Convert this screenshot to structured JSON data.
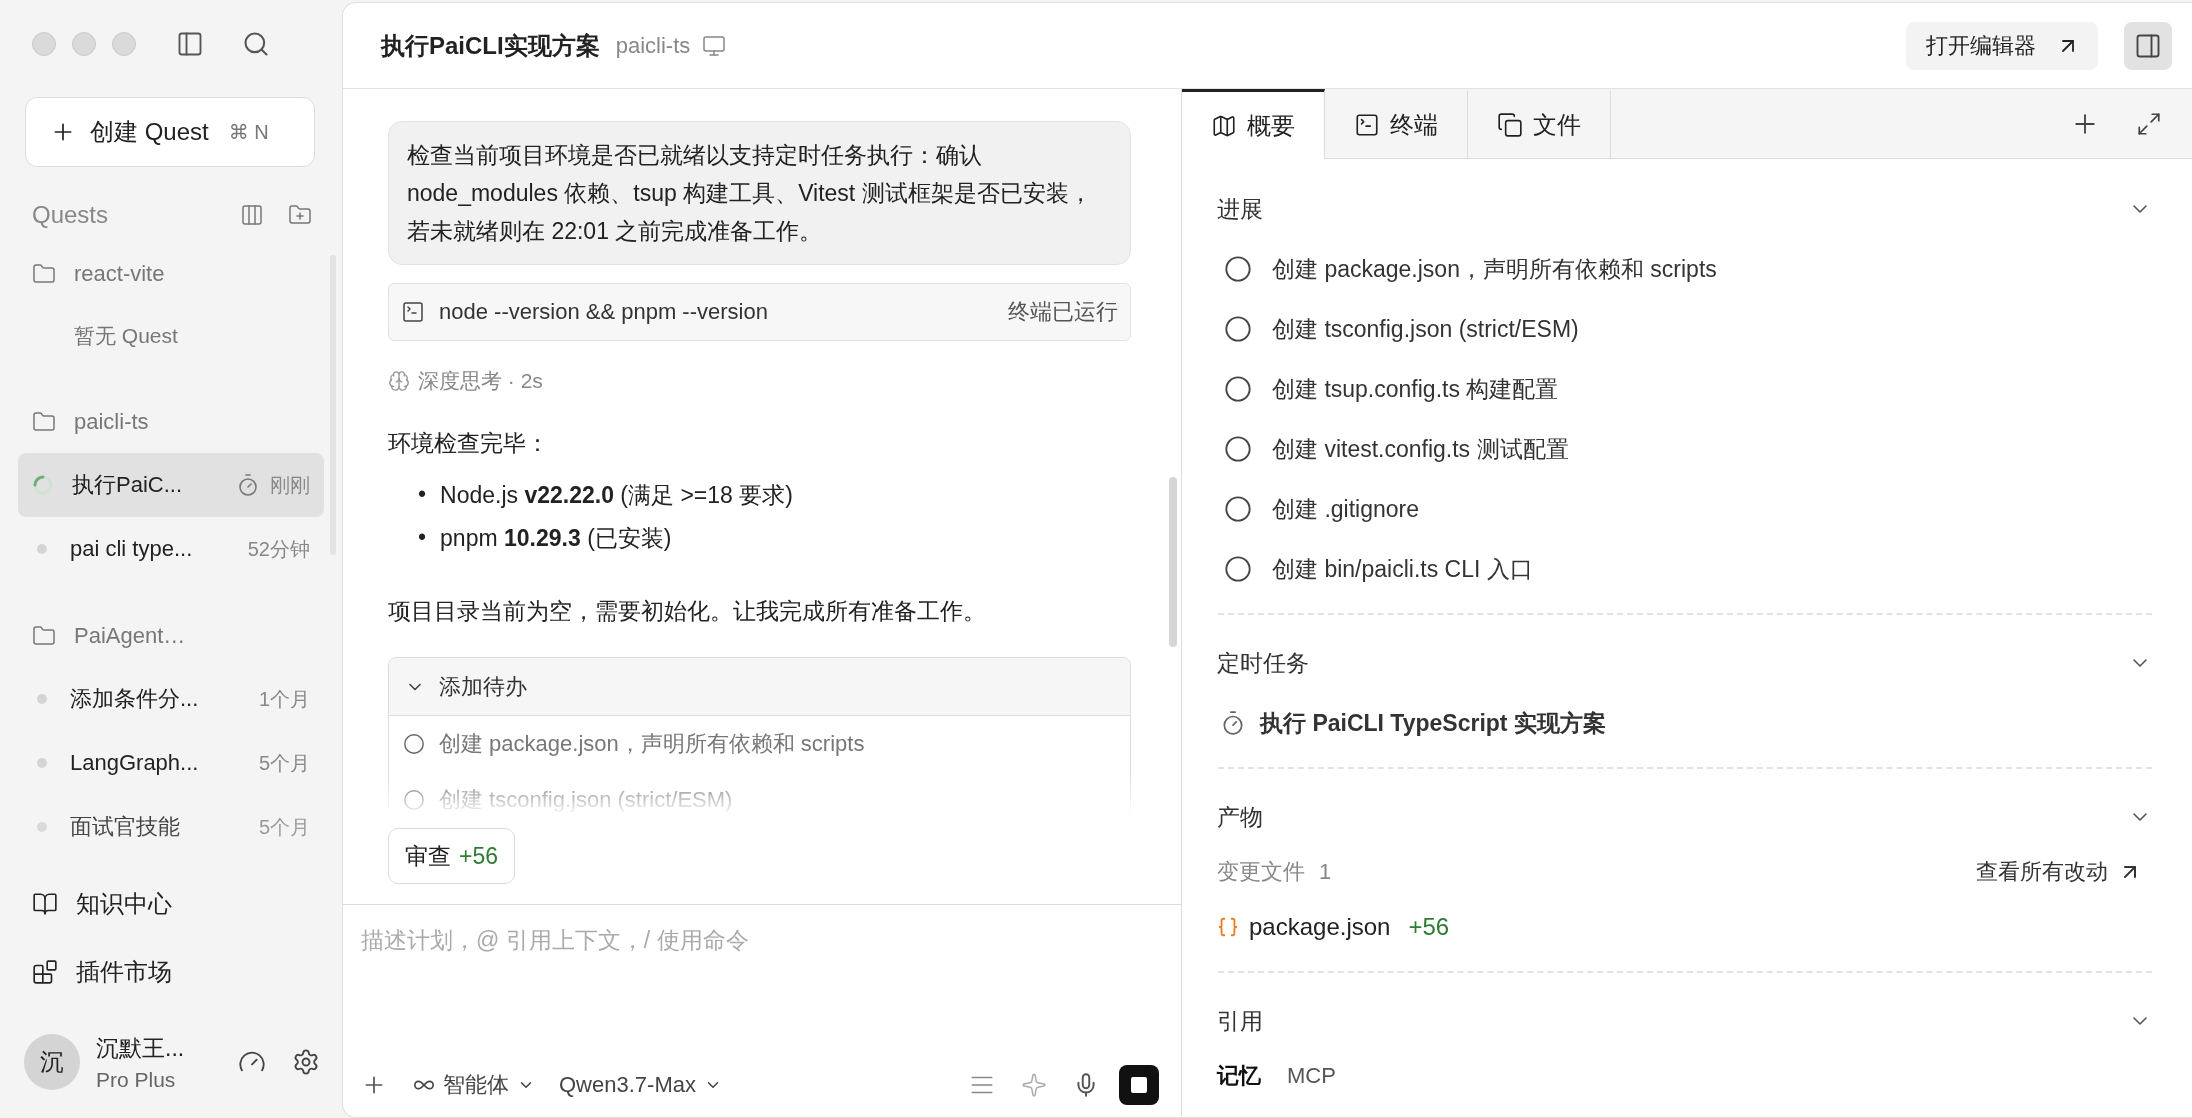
{
  "sidebar": {
    "create_button": {
      "label": "创建 Quest",
      "shortcut": "⌘ N"
    },
    "heading": "Quests",
    "groups": [
      {
        "name": "react-vite",
        "empty_text": "暂无 Quest"
      },
      {
        "name": "paicli-ts",
        "quests": [
          {
            "title": "执行PaiC...",
            "time": "刚刚",
            "kind": "running",
            "selected": true
          },
          {
            "title": "pai cli type...",
            "time": "52分钟",
            "kind": "idle",
            "selected": false
          }
        ]
      },
      {
        "name": "PaiAgent…",
        "quests": [
          {
            "title": "添加条件分...",
            "time": "1个月",
            "kind": "idle",
            "selected": false
          },
          {
            "title": "LangGraph...",
            "time": "5个月",
            "kind": "idle",
            "selected": false
          },
          {
            "title": "面试官技能",
            "time": "5个月",
            "kind": "idle",
            "selected": false
          }
        ]
      }
    ],
    "nav": [
      {
        "label": "知识中心"
      },
      {
        "label": "插件市场"
      }
    ],
    "user": {
      "avatar": "沉",
      "name": "沉默王...",
      "plan": "Pro Plus"
    }
  },
  "header": {
    "title": "执行PaiCLI实现方案",
    "project": "paicli-ts",
    "open_editor": "打开编辑器"
  },
  "chat": {
    "message": "检查当前项目环境是否已就绪以支持定时任务执行：确认 node_modules 依赖、tsup 构建工具、Vitest 测试框架是否已安装，若未就绪则在 22:01 之前完成准备工作。",
    "command": {
      "text": "node --version && pnpm --version",
      "status": "终端已运行"
    },
    "thinking": "深度思考 · 2s",
    "reply_intro": "环境检查完毕：",
    "bullets": [
      {
        "marker": "•",
        "text": "Node.js **v22.22.0** (满足 >=18 要求)"
      },
      {
        "marker": "•",
        "text": "pnpm **10.29.3** (已安装)"
      }
    ],
    "reply_text": "项目目录当前为空，需要初始化。让我完成所有准备工作。",
    "todo_card": {
      "title": "添加待办",
      "expanded": true,
      "items": [
        {
          "text": "创建 package.json，声明所有依赖和 scripts",
          "done": false
        },
        {
          "text": "创建 tsconfig.json (strict/ESM)",
          "done": false
        }
      ]
    },
    "review": {
      "label": "审查",
      "added": "+56"
    }
  },
  "composer": {
    "placeholder": "描述计划，@ 引用上下文，/ 使用命令",
    "agent": "智能体",
    "model": "Qwen3.7-Max"
  },
  "panel": {
    "tabs": [
      {
        "label": "概要",
        "selected": true
      },
      {
        "label": "终端",
        "selected": false
      },
      {
        "label": "文件",
        "selected": false
      }
    ],
    "progress": {
      "title": "进展",
      "expanded": true,
      "items": [
        {
          "text": "创建 package.json，声明所有依赖和 scripts",
          "done": false
        },
        {
          "text": "创建 tsconfig.json (strict/ESM)",
          "done": false
        },
        {
          "text": "创建 tsup.config.ts 构建配置",
          "done": false
        },
        {
          "text": "创建 vitest.config.ts 测试配置",
          "done": false
        },
        {
          "text": "创建 .gitignore",
          "done": false
        },
        {
          "text": "创建 bin/paicli.ts CLI 入口",
          "done": false
        }
      ]
    },
    "schedule": {
      "title": "定时任务",
      "expanded": true,
      "task": "执行 PaiCLI TypeScript 实现方案"
    },
    "artifacts": {
      "title": "产物",
      "expanded": true,
      "changed_label": "变更文件",
      "changed_count": "1",
      "view_all": "查看所有改动",
      "files": [
        {
          "name": "package.json",
          "added": "+56"
        }
      ]
    },
    "references": {
      "title": "引用",
      "expanded": true,
      "tabs": [
        {
          "label": "记忆",
          "selected": true
        },
        {
          "label": "MCP",
          "selected": false
        }
      ]
    }
  }
}
